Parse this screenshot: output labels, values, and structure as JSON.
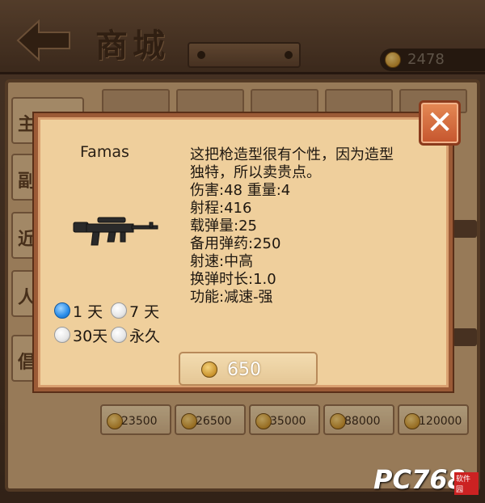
{
  "header": {
    "title": "商城",
    "coin_balance": "2478"
  },
  "sidebar": {
    "tabs": [
      {
        "label": "主"
      },
      {
        "label": "副"
      },
      {
        "label": "近"
      },
      {
        "label": "人"
      },
      {
        "label": "倡"
      }
    ]
  },
  "shelf": {
    "prices": [
      "23500",
      "26500",
      "35000",
      "88000",
      "120000"
    ]
  },
  "modal": {
    "item_name": "Famas",
    "description": [
      "这把枪造型很有个性，因为造型",
      "独特，所以卖贵点。",
      "伤害:48 重量:4",
      "射程:416",
      "载弹量:25",
      "备用弹药:250",
      "射速:中高",
      "换弹时长:1.0",
      "功能:减速-强"
    ],
    "durations": [
      {
        "label": "1 天",
        "selected": true
      },
      {
        "label": "7 天",
        "selected": false
      },
      {
        "label": "30天",
        "selected": false
      },
      {
        "label": "永久",
        "selected": false
      }
    ],
    "price": "650",
    "close_symbol": "✕"
  },
  "watermark": {
    "text": "PC768",
    "tag": "软件园"
  },
  "colors": {
    "modal_bg": "#efcf9c",
    "modal_border": "#9b5a36",
    "close_button": "#c5552e",
    "radio_selected": "#2a8ce8"
  }
}
